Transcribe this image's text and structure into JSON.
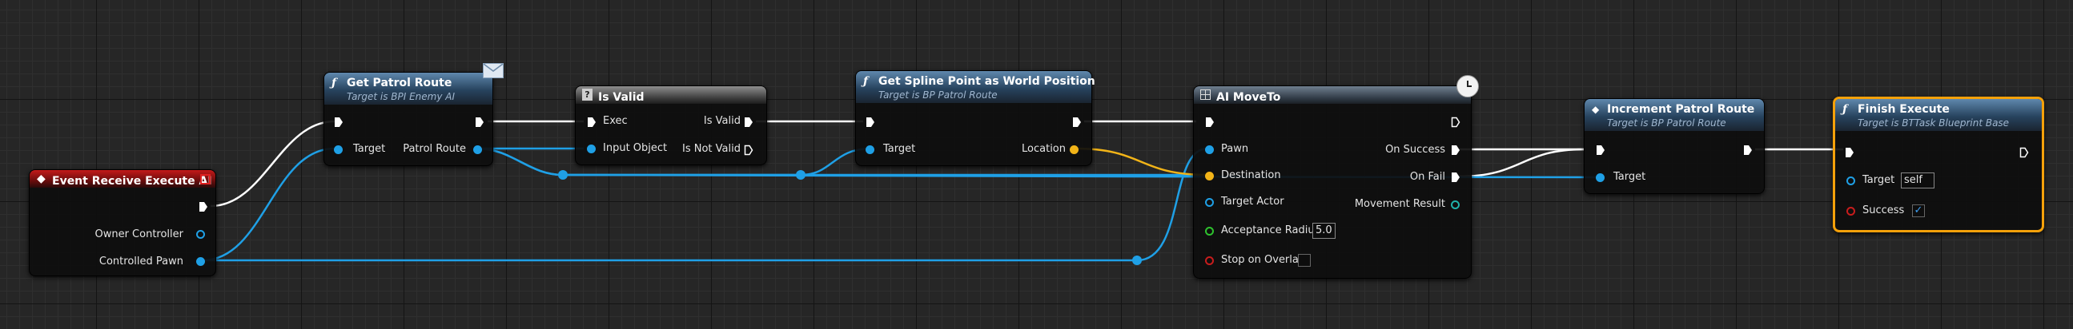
{
  "colors": {
    "exec": "#ffffff",
    "object_pin": "#1fa0e6",
    "vector_pin": "#f2b418",
    "float_pin": "#2ec22e",
    "bool_pin": "#c81d1d",
    "enum_pin": "#20b2aa",
    "selection": "#f5a10a"
  },
  "nodes": {
    "event": {
      "title": "Event Receive Execute AI",
      "icon": "event-diamond-icon",
      "owner_controller": "Owner Controller",
      "controlled_pawn": "Controlled Pawn"
    },
    "get_patrol_route": {
      "title": "Get Patrol Route",
      "subtitle": "Target is BPI Enemy AI",
      "icon": "function-icon",
      "badge": "envelope-icon",
      "target": "Target",
      "patrol_route": "Patrol Route"
    },
    "is_valid": {
      "title": "Is Valid",
      "icon": "question-icon",
      "exec": "Exec",
      "input_object": "Input Object",
      "is_valid": "Is Valid",
      "is_not_valid": "Is Not Valid"
    },
    "get_spline": {
      "title": "Get Spline Point as World Position",
      "subtitle": "Target is BP Patrol Route",
      "icon": "function-icon",
      "target": "Target",
      "location": "Location"
    },
    "ai_moveto": {
      "title": "AI MoveTo",
      "icon": "grid-icon",
      "badge": "clock-icon",
      "pawn": "Pawn",
      "destination": "Destination",
      "target_actor": "Target Actor",
      "acceptance_radius": "Acceptance Radius",
      "acceptance_radius_value": "5.0",
      "stop_on_overlap": "Stop on Overlap",
      "on_success": "On Success",
      "on_fail": "On Fail",
      "movement_result": "Movement Result"
    },
    "increment": {
      "title": "Increment Patrol Route",
      "subtitle": "Target is BP Patrol Route",
      "icon": "event-diamond-icon",
      "target": "Target"
    },
    "finish": {
      "title": "Finish Execute",
      "subtitle": "Target is BTTask Blueprint Base",
      "icon": "function-icon",
      "target": "Target",
      "target_value": "self",
      "success": "Success",
      "success_checked": true
    }
  }
}
